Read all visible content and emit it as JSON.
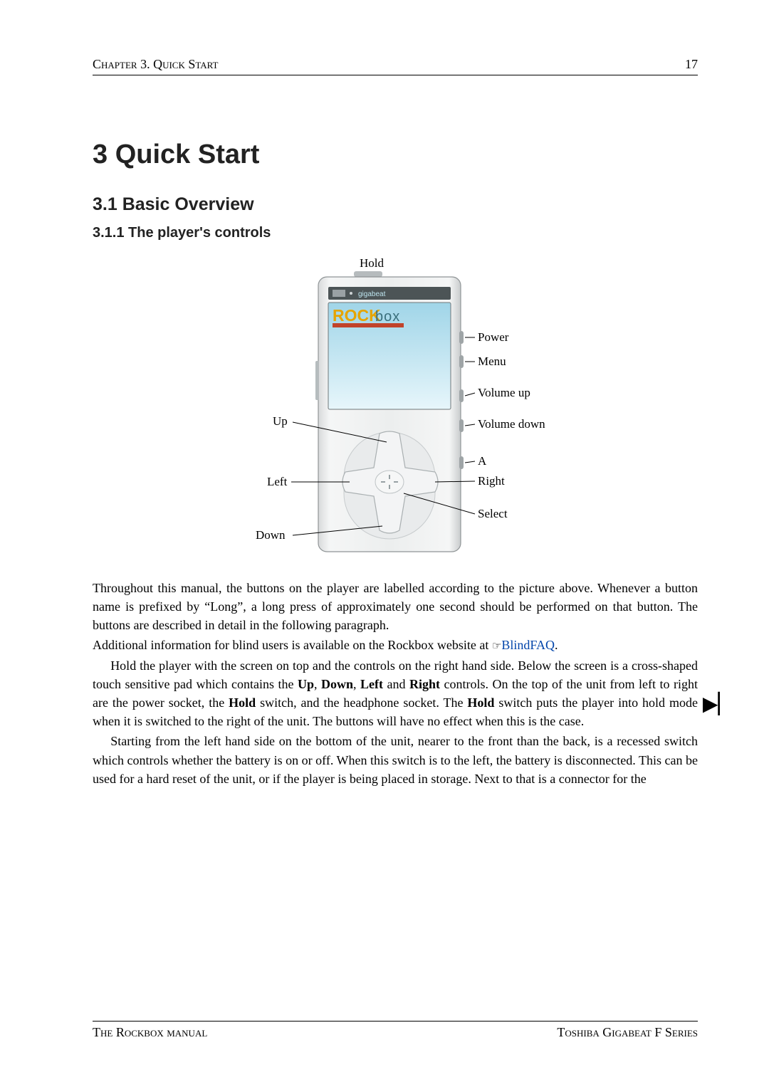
{
  "header": {
    "left": "Chapter 3.  Quick Start",
    "page": "17"
  },
  "chapterTitle": "3 Quick Start",
  "sectionTitle": "3.1 Basic Overview",
  "subsectionTitle": "3.1.1 The player's controls",
  "diagram": {
    "hold": "Hold",
    "gigabeat": "gigabeat",
    "rock": "ROCK",
    "box": "box",
    "power": "Power",
    "menu": "Menu",
    "volup": "Volume up",
    "voldown": "Volume down",
    "a": "A",
    "right": "Right",
    "select": "Select",
    "up": "Up",
    "left": "Left",
    "down": "Down"
  },
  "para1": "Throughout this manual, the buttons on the player are labelled according to the picture above. Whenever a button name is prefixed by “Long”, a long press of approximately one second should be performed on that button. The buttons are described in detail in the following paragraph.",
  "para2_pre": "Additional information for blind users is available on the Rockbox website at ",
  "para2_hand": "☞",
  "para2_link": "BlindFAQ",
  "para2_post": ".",
  "para3_a": "Hold the player with the screen on top and the controls on the right hand side. Below the screen is a cross-shaped touch sensitive pad which contains the ",
  "para3_up": "Up",
  "para3_sep1": ", ",
  "para3_down": "Down",
  "para3_sep2": ", ",
  "para3_left": "Left",
  "para3_b": " and ",
  "para3_right": "Right",
  "para3_c": " controls. On the top of the unit from left to right are the power socket, the ",
  "para3_hold1": "Hold",
  "para3_d": " switch, and the headphone socket. The ",
  "para3_hold2": "Hold",
  "para3_e": " switch puts the player into hold mode when it is switched to the right of the unit. The buttons will have no effect when this is the case.",
  "para4": "Starting from the left hand side on the bottom of the unit, nearer to the front than the back, is a recessed switch which controls whether the battery is on or off. When this switch is to the left, the battery is disconnected. This can be used for a hard reset of the unit, or if the player is being placed in storage. Next to that is a connector for the",
  "marginNote": "▶▏",
  "footer": {
    "left": "The Rockbox manual",
    "right": "Toshiba Gigabeat F Series"
  }
}
